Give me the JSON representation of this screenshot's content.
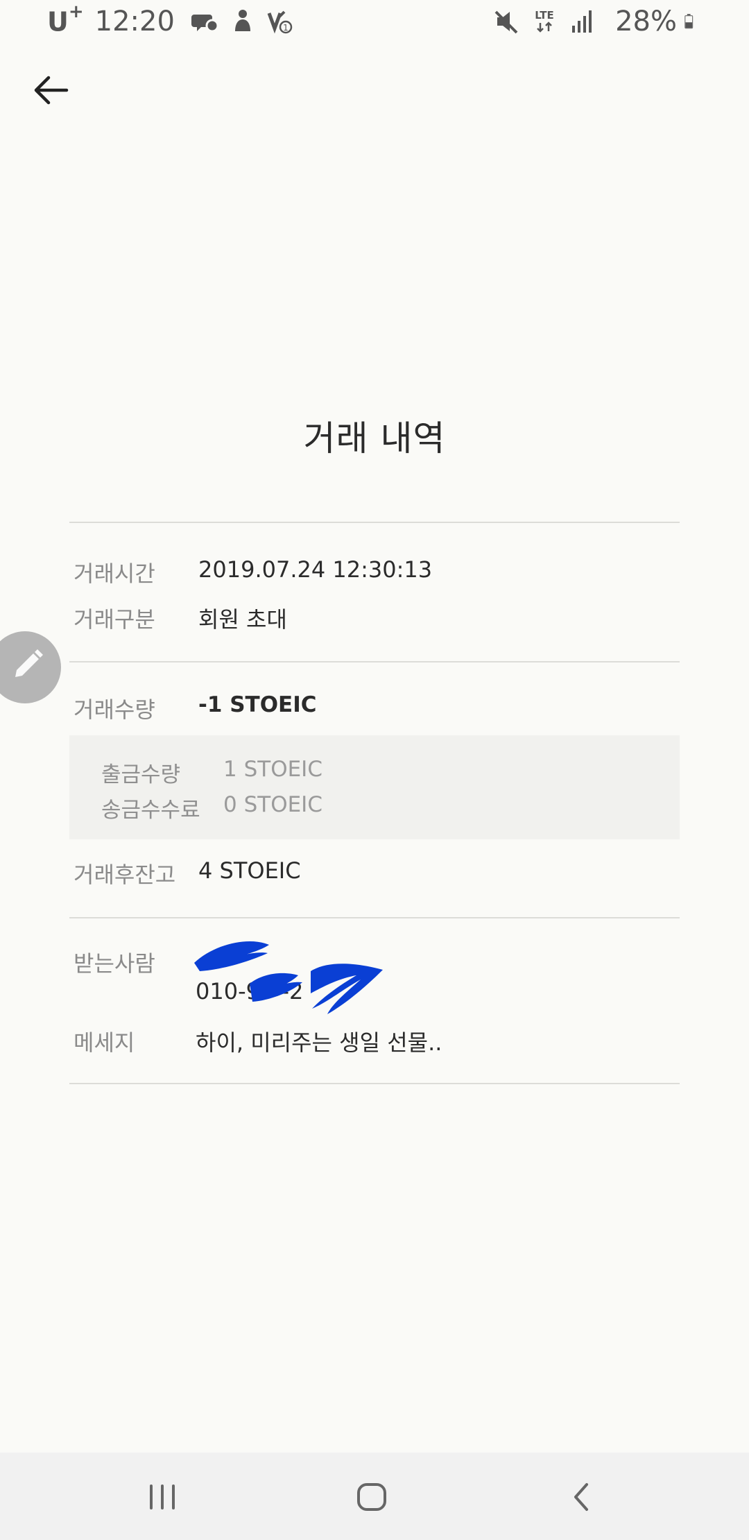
{
  "status_bar": {
    "carrier": "U",
    "carrier_sup": "+",
    "time": "12:20",
    "battery": "28%",
    "network": "LTE",
    "icons": [
      "chat-icon",
      "person-icon",
      "missed-call-icon",
      "mute-icon",
      "lte-icon",
      "signal-icon",
      "battery-icon"
    ]
  },
  "header": {
    "back_icon": "back-arrow-icon",
    "title": "거래 내역"
  },
  "details": {
    "time_label": "거래시간",
    "time_value": "2019.07.24 12:30:13",
    "type_label": "거래구분",
    "type_value": "회원 초대",
    "amount_label": "거래수량",
    "amount_value": "-1 STOEIC",
    "withdraw_label": "출금수량",
    "withdraw_value": "1 STOEIC",
    "fee_label": "송금수수료",
    "fee_value": "0 STOEIC",
    "balance_label": "거래후잔고",
    "balance_value": "4 STOEIC",
    "recipient_label": "받는사람",
    "recipient_phone": "010-9   -2",
    "message_label": "메세지",
    "message_value": "하이, 미리주는 생일 선물.."
  },
  "fab": {
    "icon": "pencil-icon"
  },
  "nav_bar": {
    "recent_icon": "recent-apps-icon",
    "home_icon": "home-icon",
    "back_icon": "nav-back-icon"
  },
  "colors": {
    "background": "#fafaf7",
    "redaction": "#0a3fd4",
    "fab": "#b5b5b5",
    "nav_bar": "#f1f1f1"
  }
}
